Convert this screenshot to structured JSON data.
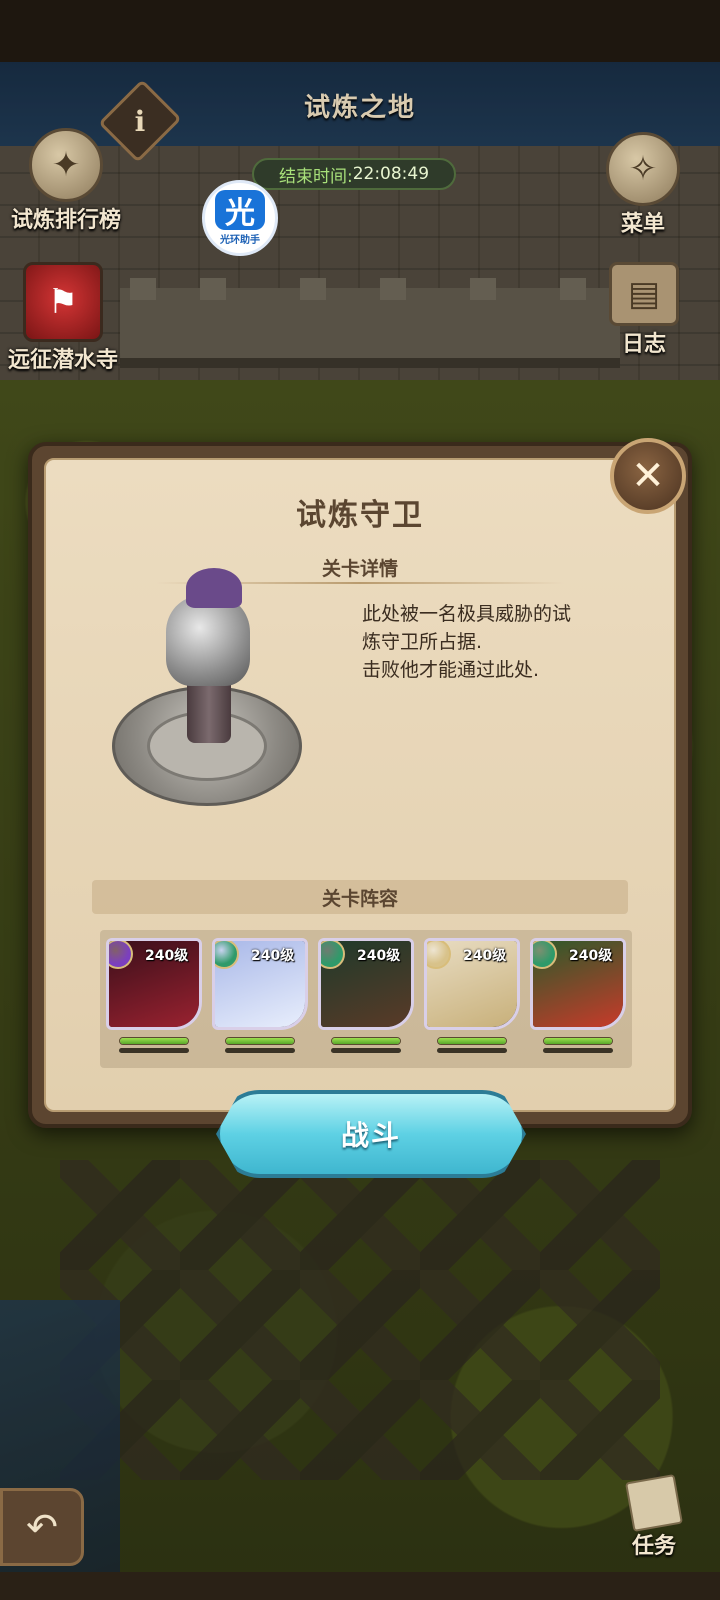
{
  "header": {
    "title": "试炼之地"
  },
  "timer": {
    "label": "结束时间:",
    "value": "22:08:49"
  },
  "side_buttons": {
    "ranking": "试炼排行榜",
    "expedition": "远征潜水寺",
    "menu": "菜单",
    "journal": "日志",
    "quest": "任务"
  },
  "assistant_badge": {
    "glyph": "光",
    "text": "光环助手"
  },
  "dialog": {
    "title": "试炼守卫",
    "details_header": "关卡详情",
    "description": "此处被一名极具威胁的试\n炼守卫所占据.\n击败他才能通过此处.",
    "lineup_header": "关卡阵容",
    "fight_button": "战斗"
  },
  "heroes": [
    {
      "level": "240级",
      "badge_color": "#7b3fbf",
      "portrait_colors": [
        "#3a0f1a",
        "#9a2230"
      ],
      "hp": 1.0
    },
    {
      "level": "240级",
      "badge_color": "#2f9a6a",
      "portrait_colors": [
        "#a9b8e8",
        "#e8eefc"
      ],
      "hp": 1.0
    },
    {
      "level": "240级",
      "badge_color": "#2f9a6a",
      "portrait_colors": [
        "#1f3a2a",
        "#5a3a28"
      ],
      "hp": 1.0
    },
    {
      "level": "240级",
      "badge_color": "#d8c28a",
      "portrait_colors": [
        "#e8dcc2",
        "#c8b07a"
      ],
      "hp": 1.0
    },
    {
      "level": "240级",
      "badge_color": "#2f9a6a",
      "portrait_colors": [
        "#2c5a2a",
        "#c83a2a"
      ],
      "hp": 1.0
    }
  ]
}
